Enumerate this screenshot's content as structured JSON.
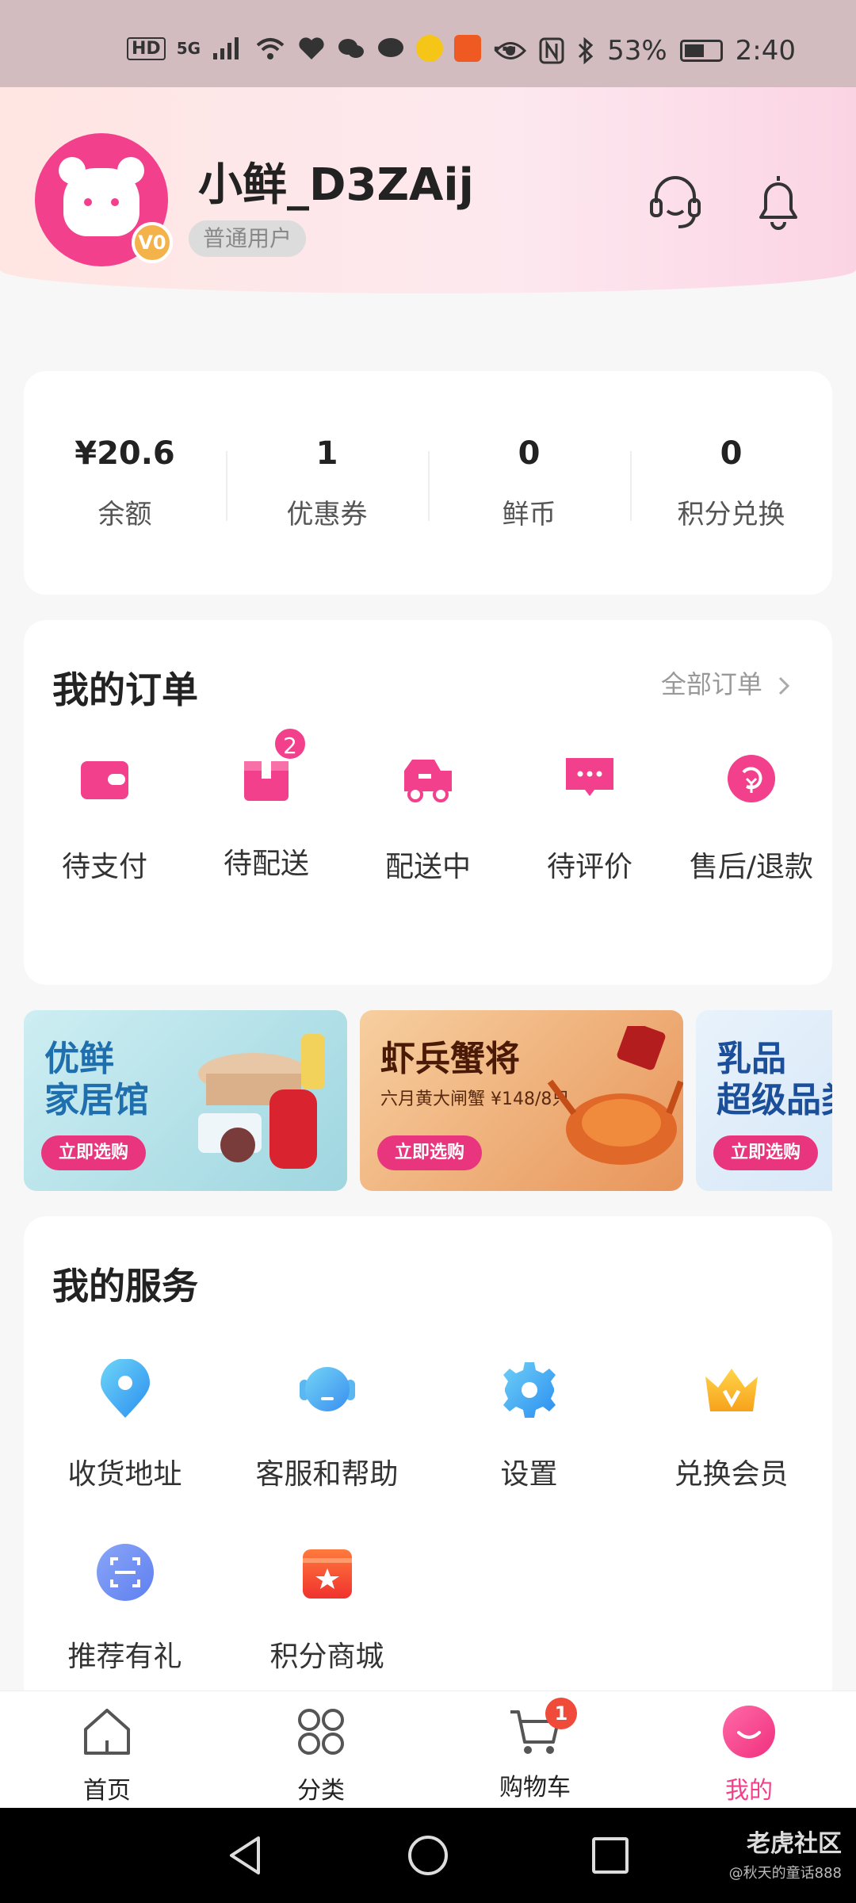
{
  "status_bar": {
    "left_labels": [
      "HD",
      "5G"
    ],
    "more": "···",
    "battery_percent": "53%",
    "time": "2:40"
  },
  "user": {
    "name": "小鲜_D3ZAij",
    "level_badge": "V0",
    "tag": "普通用户"
  },
  "stats": [
    {
      "value": "¥20.6",
      "label": "余额"
    },
    {
      "value": "1",
      "label": "优惠券"
    },
    {
      "value": "0",
      "label": "鲜币"
    },
    {
      "value": "0",
      "label": "积分兑换"
    }
  ],
  "orders": {
    "title": "我的订单",
    "all_link": "全部订单",
    "items": [
      {
        "label": "待支付",
        "icon": "wallet-icon"
      },
      {
        "label": "待配送",
        "icon": "package-icon",
        "badge": "2"
      },
      {
        "label": "配送中",
        "icon": "delivery-truck-icon"
      },
      {
        "label": "待评价",
        "icon": "comment-icon"
      },
      {
        "label": "售后/退款",
        "icon": "refund-icon"
      }
    ]
  },
  "banners": [
    {
      "title_line1": "优鲜",
      "title_line2": "家居馆",
      "button": "立即选购"
    },
    {
      "title_line1": "虾兵蟹将",
      "subtitle": "六月黄大闸蟹 ¥148/8只",
      "button": "立即选购"
    },
    {
      "title_line1": "乳品",
      "title_line2": "超级品类",
      "button": "立即选购"
    }
  ],
  "services": {
    "title": "我的服务",
    "items": [
      {
        "label": "收货地址",
        "icon": "location-pin-icon"
      },
      {
        "label": "客服和帮助",
        "icon": "customer-service-icon"
      },
      {
        "label": "设置",
        "icon": "gear-icon"
      },
      {
        "label": "兑换会员",
        "icon": "crown-icon"
      },
      {
        "label": "推荐有礼",
        "icon": "scan-icon"
      },
      {
        "label": "积分商城",
        "icon": "store-icon"
      }
    ]
  },
  "bottom_nav": [
    {
      "label": "首页",
      "icon": "home-icon"
    },
    {
      "label": "分类",
      "icon": "grid-icon"
    },
    {
      "label": "购物车",
      "icon": "cart-icon",
      "badge": "1"
    },
    {
      "label": "我的",
      "icon": "profile-face-icon",
      "active": true
    }
  ],
  "watermark": {
    "main": "老虎社区",
    "sub": "@秋天的童话888"
  },
  "colors": {
    "accent": "#f2408c",
    "badge_red": "#f04a3a"
  }
}
